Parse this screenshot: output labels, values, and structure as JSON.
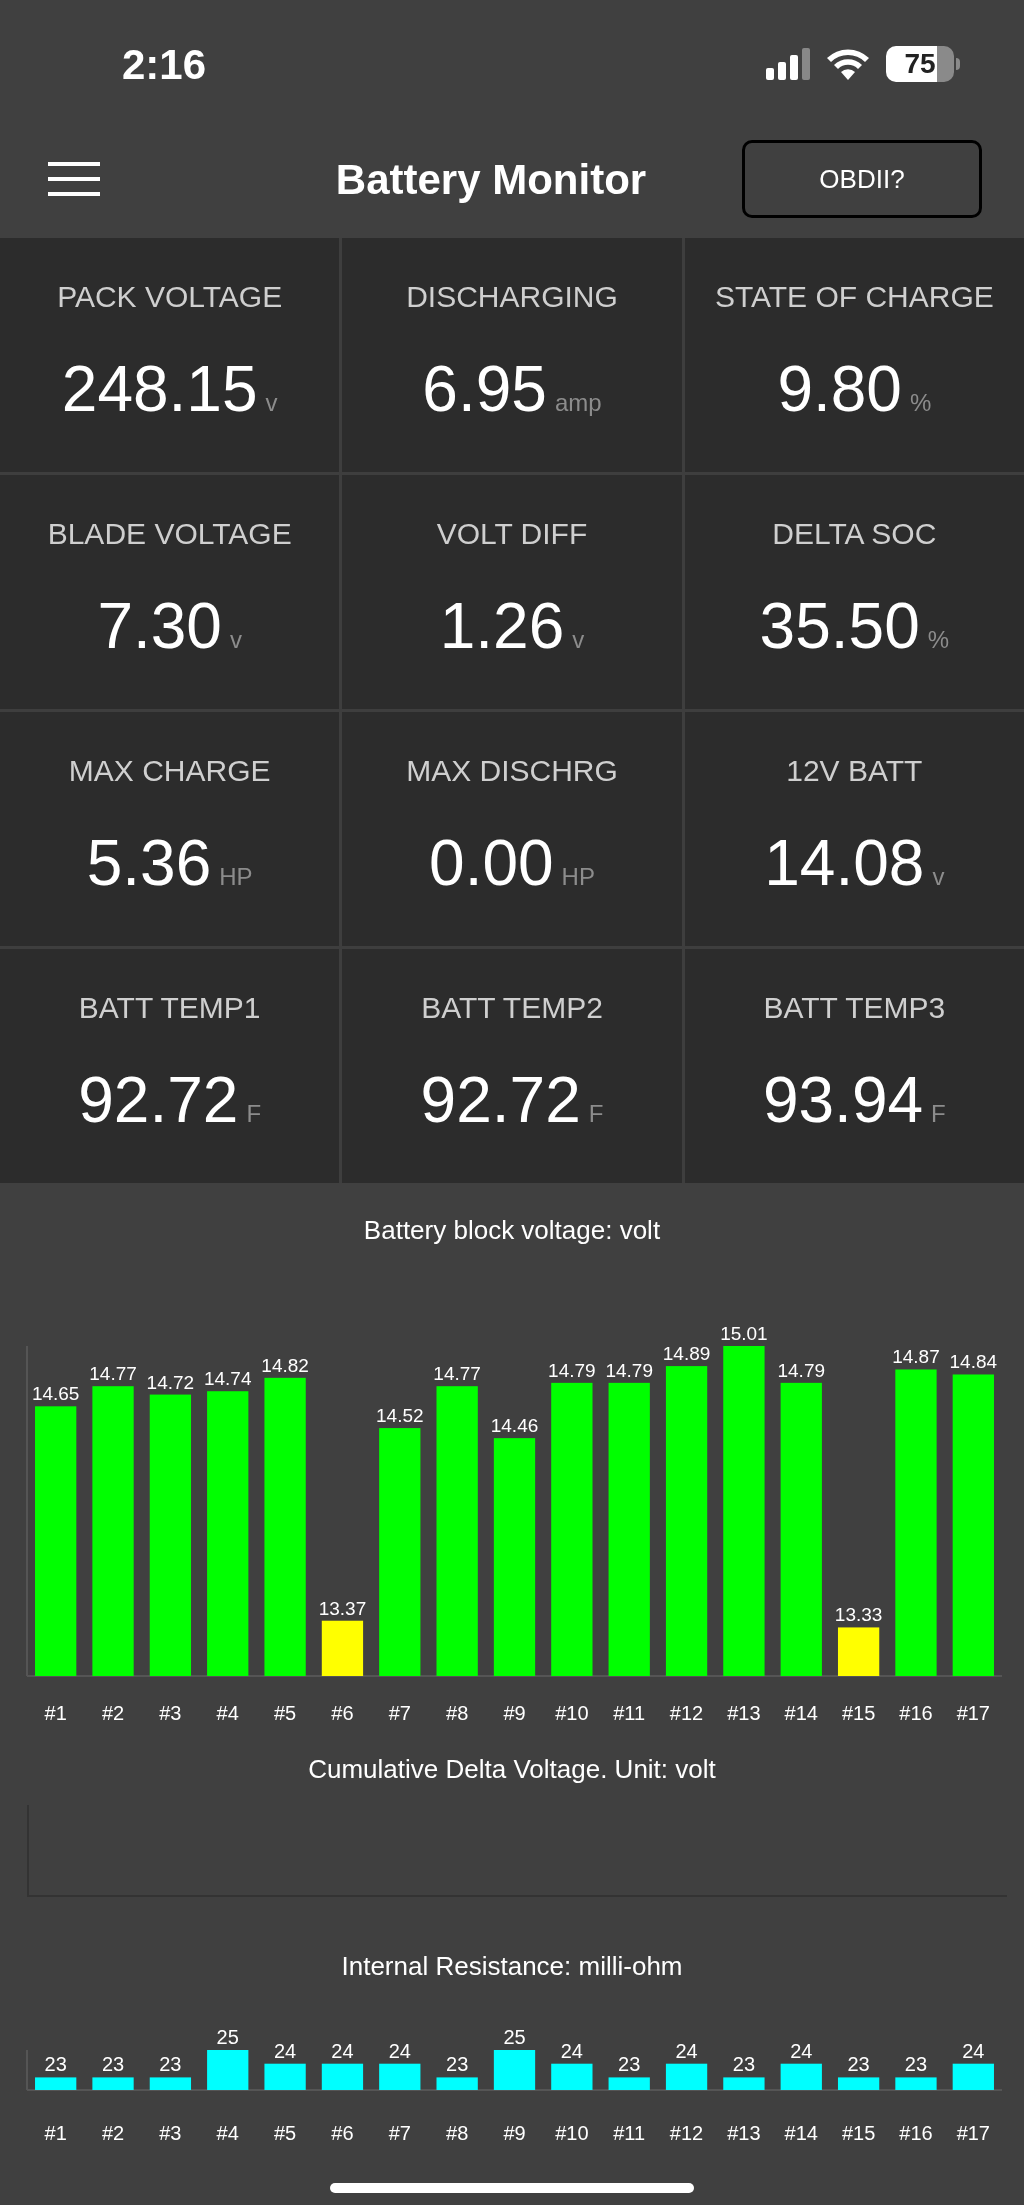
{
  "status_bar": {
    "time": "2:16",
    "battery": "75"
  },
  "nav": {
    "title": "Battery Monitor",
    "button": "OBDII?"
  },
  "metrics": [
    {
      "label": "PACK VOLTAGE",
      "value": "248.15",
      "unit": "v"
    },
    {
      "label": "DISCHARGING",
      "value": "6.95",
      "unit": "amp"
    },
    {
      "label": "STATE OF CHARGE",
      "value": "9.80",
      "unit": "%"
    },
    {
      "label": "BLADE VOLTAGE",
      "value": "7.30",
      "unit": "v"
    },
    {
      "label": "VOLT DIFF",
      "value": "1.26",
      "unit": "v"
    },
    {
      "label": "DELTA SOC",
      "value": "35.50",
      "unit": "%"
    },
    {
      "label": "MAX CHARGE",
      "value": "5.36",
      "unit": "HP"
    },
    {
      "label": "MAX DISCHRG",
      "value": "0.00",
      "unit": "HP"
    },
    {
      "label": "12V BATT",
      "value": "14.08",
      "unit": "v"
    },
    {
      "label": "BATT TEMP1",
      "value": "92.72",
      "unit": "F"
    },
    {
      "label": "BATT TEMP2",
      "value": "92.72",
      "unit": "F"
    },
    {
      "label": "BATT TEMP3",
      "value": "93.94",
      "unit": "F"
    }
  ],
  "charts": [
    {
      "title": "Battery block voltage: volt",
      "chart_data": {
        "type": "bar",
        "categories": [
          "#1",
          "#2",
          "#3",
          "#4",
          "#5",
          "#6",
          "#7",
          "#8",
          "#9",
          "#10",
          "#11",
          "#12",
          "#13",
          "#14",
          "#15",
          "#16",
          "#17"
        ],
        "stacked": true,
        "data_labels": true,
        "ylim": [
          13.04,
          15.01
        ],
        "series": [
          {
            "color": "#00ff00",
            "values": [
              14.65,
              14.77,
              14.72,
              14.74,
              14.82,
              null,
              14.52,
              14.77,
              14.46,
              14.79,
              14.79,
              14.89,
              15.01,
              14.79,
              null,
              14.87,
              14.84
            ]
          },
          {
            "color": "#ffff00",
            "values": [
              null,
              null,
              null,
              null,
              null,
              13.37,
              null,
              null,
              null,
              null,
              null,
              null,
              null,
              null,
              13.33,
              null,
              null
            ]
          }
        ]
      }
    },
    {
      "title": "Cumulative Delta Voltage. Unit: volt"
    },
    {
      "title": "Internal Resistance: milli-ohm",
      "chart_data": {
        "type": "bar",
        "categories": [
          "#1",
          "#2",
          "#3",
          "#4",
          "#5",
          "#6",
          "#7",
          "#8",
          "#9",
          "#10",
          "#11",
          "#12",
          "#13",
          "#14",
          "#15",
          "#16",
          "#17"
        ],
        "data_labels": true,
        "ylim": [
          22.08,
          25
        ],
        "series": [
          {
            "color": "#00ffff",
            "values": [
              23,
              23,
              23,
              25,
              24,
              24,
              24,
              23,
              25,
              24,
              23,
              24,
              23,
              24,
              23,
              23,
              24
            ]
          }
        ]
      }
    }
  ]
}
